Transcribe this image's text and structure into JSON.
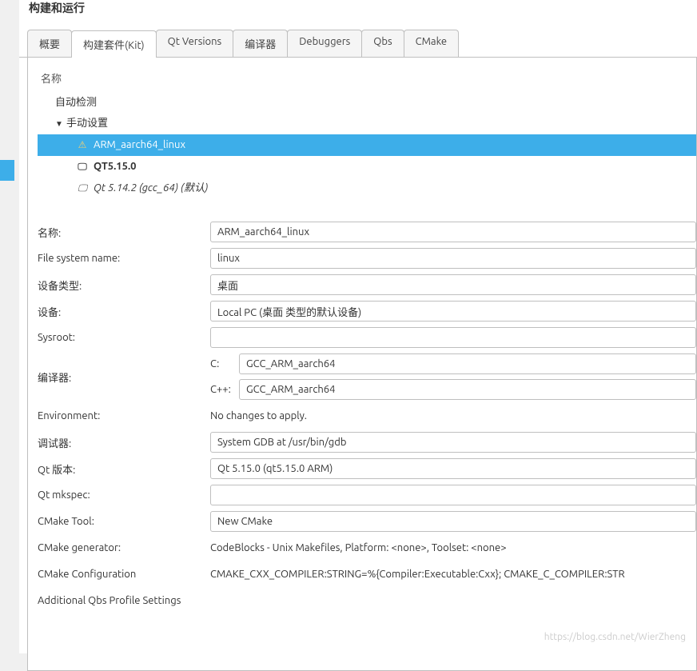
{
  "title": "构建和运行",
  "tabs": [
    {
      "id": "overview",
      "label": "概要"
    },
    {
      "id": "kit",
      "label": "构建套件(Kit)",
      "active": true
    },
    {
      "id": "qtversions",
      "label": "Qt Versions"
    },
    {
      "id": "compilers",
      "label": "编译器"
    },
    {
      "id": "debuggers",
      "label": "Debuggers"
    },
    {
      "id": "qbs",
      "label": "Qbs"
    },
    {
      "id": "cmake",
      "label": "CMake"
    }
  ],
  "tree": {
    "header": "名称",
    "auto_label": "自动检测",
    "manual_label": "手动设置",
    "items": [
      {
        "id": "arm",
        "label": "ARM_aarch64_linux",
        "icon": "warning",
        "selected": true
      },
      {
        "id": "qt5150",
        "label": "QT5.15.0",
        "icon": "monitor",
        "bold": true
      },
      {
        "id": "qt5142",
        "label": "Qt 5.14.2 (gcc_64) (默认)",
        "icon": "monitor",
        "italic": true
      }
    ]
  },
  "form": {
    "name_label": "名称:",
    "name_value": "ARM_aarch64_linux",
    "fsname_label": "File system name:",
    "fsname_value": "linux",
    "devtype_label": "设备类型:",
    "devtype_value": "桌面",
    "device_label": "设备:",
    "device_value": "Local PC (桌面 类型的默认设备)",
    "sysroot_label": "Sysroot:",
    "sysroot_value": "",
    "compiler_label": "编译器:",
    "c_label": "C:",
    "c_value": "GCC_ARM_aarch64",
    "cxx_label": "C++:",
    "cxx_value": "GCC_ARM_aarch64",
    "env_label": "Environment:",
    "env_value": "No changes to apply.",
    "debugger_label": "调试器:",
    "debugger_value": "System GDB at /usr/bin/gdb",
    "qtver_label": "Qt 版本:",
    "qtver_value": "Qt 5.15.0 (qt5.15.0 ARM)",
    "mkspec_label": "Qt mkspec:",
    "mkspec_value": "",
    "cmaketool_label": "CMake Tool:",
    "cmaketool_value": "New CMake",
    "cmakegen_label": "CMake generator:",
    "cmakegen_value": "CodeBlocks - Unix Makefiles, Platform: <none>, Toolset: <none>",
    "cmakeconf_label": "CMake Configuration",
    "cmakeconf_value": "CMAKE_CXX_COMPILER:STRING=%{Compiler:Executable:Cxx}; CMAKE_C_COMPILER:STR",
    "qbs_label": "Additional Qbs Profile Settings"
  },
  "watermark": "https://blog.csdn.net/WierZheng"
}
